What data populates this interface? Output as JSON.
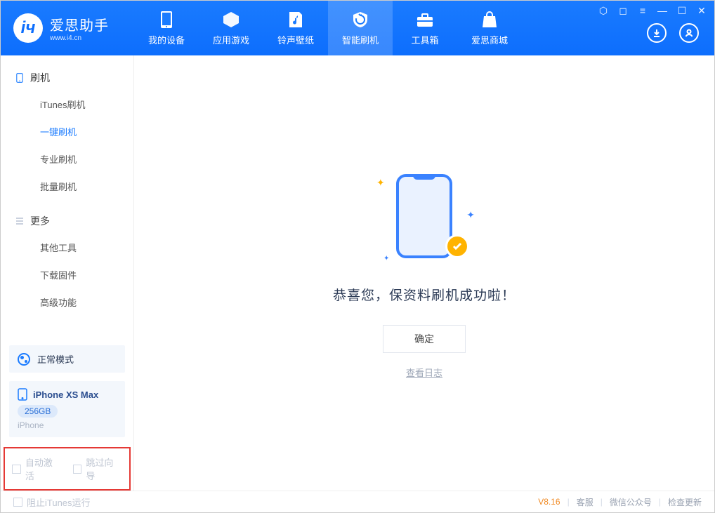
{
  "app": {
    "name": "爱思助手",
    "domain": "www.i4.cn"
  },
  "nav": {
    "items": [
      {
        "label": "我的设备"
      },
      {
        "label": "应用游戏"
      },
      {
        "label": "铃声壁纸"
      },
      {
        "label": "智能刷机"
      },
      {
        "label": "工具箱"
      },
      {
        "label": "爱思商城"
      }
    ],
    "active_index": 3
  },
  "sidebar": {
    "group1": {
      "title": "刷机",
      "items": [
        "iTunes刷机",
        "一键刷机",
        "专业刷机",
        "批量刷机"
      ],
      "active_index": 1
    },
    "group2": {
      "title": "更多",
      "items": [
        "其他工具",
        "下载固件",
        "高级功能"
      ]
    }
  },
  "mode": {
    "label": "正常模式"
  },
  "device": {
    "name": "iPhone XS Max",
    "capacity": "256GB",
    "type": "iPhone"
  },
  "options": {
    "auto_activate": "自动激活",
    "skip_guide": "跳过向导"
  },
  "main": {
    "message": "恭喜您，保资料刷机成功啦！",
    "ok": "确定",
    "view_log": "查看日志"
  },
  "footer": {
    "block_itunes": "阻止iTunes运行",
    "version": "V8.16",
    "support": "客服",
    "wechat": "微信公众号",
    "check_update": "检查更新"
  }
}
